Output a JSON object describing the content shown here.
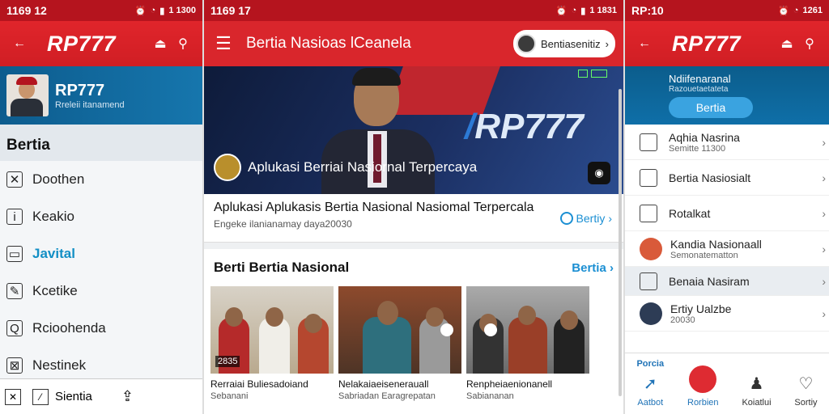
{
  "panel_left": {
    "status": {
      "time": "1169 12",
      "right": "1 1300"
    },
    "brand": "RP777",
    "profile": {
      "name": "RP777",
      "subtitle": "Rreleii itanamend"
    },
    "section": "Bertia",
    "items": [
      {
        "label": "Doothen",
        "icon": "document-icon"
      },
      {
        "label": "Keakio",
        "icon": "info-icon"
      },
      {
        "label": "Javital",
        "icon": "folder-icon",
        "active": true
      },
      {
        "label": "Kcetike",
        "icon": "edit-icon"
      },
      {
        "label": "Rcioohenda",
        "icon": "search-icon"
      },
      {
        "label": "Nestinek",
        "icon": "image-icon"
      }
    ],
    "bottom": {
      "label": "Sientia"
    }
  },
  "panel_mid": {
    "status": {
      "time": "1169 17",
      "right": "1 1831"
    },
    "title": "Bertia Nasioas lCeanela",
    "chip_label": "Bentiasenitiz",
    "hero_caption": "Aplukasi Berriai Nasiornal Terpercaya",
    "hero_logo": "RP777",
    "card": {
      "title": "Aplukasi Aplukasis Bertia Nasional Nasiomal Terpercala",
      "subtitle": "Engeke ilanianamay daya20030",
      "link": "Bertiy"
    },
    "news": {
      "header": "Berti Bertia Nasional",
      "more": "Bertia"
    },
    "tiles": [
      {
        "title": "Rerraiai Buliesadoiand",
        "subtitle": "Sebanani",
        "badge": "2835"
      },
      {
        "title": "Nelakaiaeisenerauall",
        "subtitle": "Sabriadan Earagrepatan",
        "badge": ""
      },
      {
        "title": "Renpheiaenionanell",
        "subtitle": "Sabiananan",
        "badge": ""
      }
    ]
  },
  "panel_right": {
    "status": {
      "time": "RP:10",
      "right": "1261"
    },
    "brand": "RP777",
    "banner": {
      "title": "Ndiifenaranal",
      "subtitle": "Razouetaetateta",
      "button": "Bertia"
    },
    "rows": [
      {
        "title": "Aqhia Nasrina",
        "sub": "Semitte 11300"
      },
      {
        "title": "Bertia Nasiosialt",
        "sub": ""
      },
      {
        "title": "Rotalkat",
        "sub": ""
      },
      {
        "title": "Kandia Nasionaall",
        "sub": "Semonatematton"
      },
      {
        "title": "Benaia Nasiram",
        "sub": ""
      },
      {
        "title": "Ertiy Ualzbe",
        "sub": "20030"
      }
    ],
    "bottom_nav": [
      {
        "label": "Aatbot",
        "top": "Porcia"
      },
      {
        "label": "Rorbien",
        "top": ""
      },
      {
        "label": "Koiatlui",
        "top": ""
      },
      {
        "label": "Sortiy",
        "top": ""
      }
    ]
  },
  "colors": {
    "red": "#d9262c",
    "blue": "#0f6fa8",
    "accent": "#1b8fd3"
  }
}
